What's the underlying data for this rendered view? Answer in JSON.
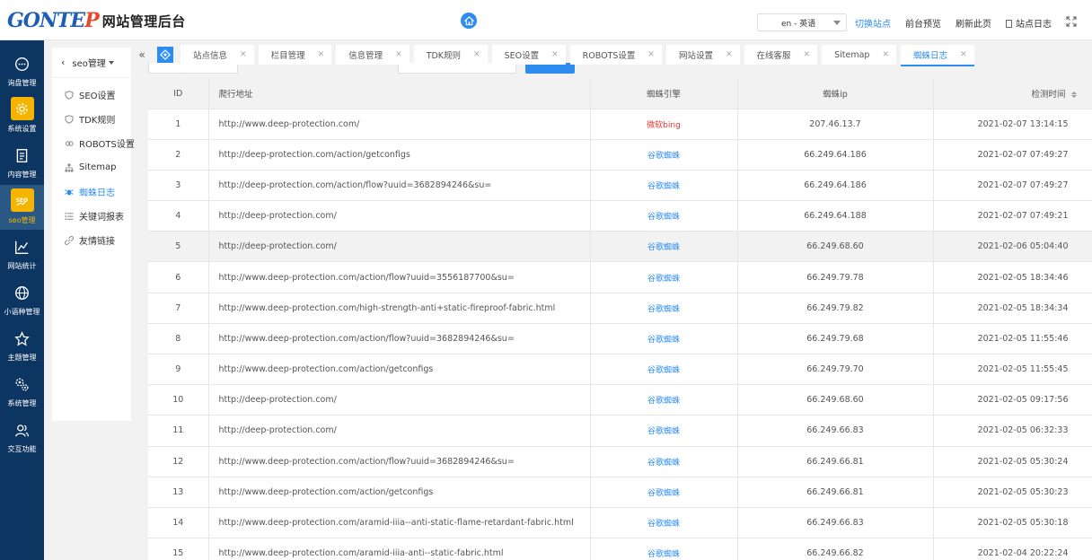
{
  "header": {
    "logo_text_main": "GONTE",
    "logo_text_p": "P",
    "title": "网站管理后台",
    "language": "en - 英语",
    "links": {
      "switch_site": "切换站点",
      "preview": "前台预览",
      "refresh": "刷新此页",
      "site_log": "站点日志"
    }
  },
  "sidebar": {
    "items": [
      {
        "label": "询盘管理",
        "icon": "chat-icon"
      },
      {
        "label": "系统设置",
        "icon": "gear-icon"
      },
      {
        "label": "内容管理",
        "icon": "document-icon"
      },
      {
        "label": "seo管理",
        "icon": "seo-icon"
      },
      {
        "label": "网站统计",
        "icon": "chart-icon"
      },
      {
        "label": "小语种管理",
        "icon": "globe-icon"
      },
      {
        "label": "主题管理",
        "icon": "theme-icon"
      },
      {
        "label": "系统管理",
        "icon": "cogs-icon"
      },
      {
        "label": "交互功能",
        "icon": "users-icon"
      }
    ]
  },
  "submenu": {
    "title": "seo管理",
    "items": [
      {
        "label": "SEO设置",
        "icon": "shield-icon"
      },
      {
        "label": "TDK规则",
        "icon": "shield-icon"
      },
      {
        "label": "ROBOTS设置",
        "icon": "robot-icon"
      },
      {
        "label": "Sitemap",
        "icon": "sitemap-icon"
      },
      {
        "label": "蜘蛛日志",
        "icon": "spider-icon"
      },
      {
        "label": "关键词报表",
        "icon": "list-icon"
      },
      {
        "label": "友情链接",
        "icon": "link-icon"
      }
    ]
  },
  "tabs": [
    {
      "label": "站点信息"
    },
    {
      "label": "栏目管理"
    },
    {
      "label": "信息管理"
    },
    {
      "label": "TDK规则"
    },
    {
      "label": "SEO设置"
    },
    {
      "label": "ROBOTS设置"
    },
    {
      "label": "网站设置"
    },
    {
      "label": "在线客服"
    },
    {
      "label": "Sitemap"
    },
    {
      "label": "蜘蛛日志"
    }
  ],
  "table": {
    "headers": {
      "id": "ID",
      "url": "爬行地址",
      "engine": "蜘蛛引擎",
      "ip": "蜘蛛ip",
      "time": "检测时间"
    },
    "colors": {
      "bing": "#e8382c",
      "google": "#2d8cf0"
    },
    "rows": [
      {
        "id": "1",
        "url": "http://www.deep-protection.com/",
        "engine": "微软bing",
        "engine_type": "bing",
        "ip": "207.46.13.7",
        "time": "2021-02-07 13:14:15"
      },
      {
        "id": "2",
        "url": "http://deep-protection.com/action/getconfigs",
        "engine": "谷歌蜘蛛",
        "engine_type": "google",
        "ip": "66.249.64.186",
        "time": "2021-02-07 07:49:27"
      },
      {
        "id": "3",
        "url": "http://deep-protection.com/action/flow?uuid=3682894246&su=",
        "engine": "谷歌蜘蛛",
        "engine_type": "google",
        "ip": "66.249.64.186",
        "time": "2021-02-07 07:49:27"
      },
      {
        "id": "4",
        "url": "http://deep-protection.com/",
        "engine": "谷歌蜘蛛",
        "engine_type": "google",
        "ip": "66.249.64.188",
        "time": "2021-02-07 07:49:21"
      },
      {
        "id": "5",
        "url": "http://deep-protection.com/",
        "engine": "谷歌蜘蛛",
        "engine_type": "google",
        "ip": "66.249.68.60",
        "time": "2021-02-06 05:04:40"
      },
      {
        "id": "6",
        "url": "http://www.deep-protection.com/action/flow?uuid=3556187700&su=",
        "engine": "谷歌蜘蛛",
        "engine_type": "google",
        "ip": "66.249.79.78",
        "time": "2021-02-05 18:34:46"
      },
      {
        "id": "7",
        "url": "http://www.deep-protection.com/high-strength-anti+static-fireproof-fabric.html",
        "engine": "谷歌蜘蛛",
        "engine_type": "google",
        "ip": "66.249.79.82",
        "time": "2021-02-05 18:34:34"
      },
      {
        "id": "8",
        "url": "http://www.deep-protection.com/action/flow?uuid=3682894246&su=",
        "engine": "谷歌蜘蛛",
        "engine_type": "google",
        "ip": "66.249.79.68",
        "time": "2021-02-05 11:55:46"
      },
      {
        "id": "9",
        "url": "http://www.deep-protection.com/action/getconfigs",
        "engine": "谷歌蜘蛛",
        "engine_type": "google",
        "ip": "66.249.79.70",
        "time": "2021-02-05 11:55:45"
      },
      {
        "id": "10",
        "url": "http://deep-protection.com/",
        "engine": "谷歌蜘蛛",
        "engine_type": "google",
        "ip": "66.249.68.60",
        "time": "2021-02-05 09:17:56"
      },
      {
        "id": "11",
        "url": "http://deep-protection.com/",
        "engine": "谷歌蜘蛛",
        "engine_type": "google",
        "ip": "66.249.66.83",
        "time": "2021-02-05 06:32:33"
      },
      {
        "id": "12",
        "url": "http://www.deep-protection.com/action/flow?uuid=3682894246&su=",
        "engine": "谷歌蜘蛛",
        "engine_type": "google",
        "ip": "66.249.66.81",
        "time": "2021-02-05 05:30:24"
      },
      {
        "id": "13",
        "url": "http://www.deep-protection.com/action/getconfigs",
        "engine": "谷歌蜘蛛",
        "engine_type": "google",
        "ip": "66.249.66.81",
        "time": "2021-02-05 05:30:23"
      },
      {
        "id": "14",
        "url": "http://www.deep-protection.com/aramid-iiia--anti-static-flame-retardant-fabric.html",
        "engine": "谷歌蜘蛛",
        "engine_type": "google",
        "ip": "66.249.66.83",
        "time": "2021-02-05 05:30:18"
      },
      {
        "id": "15",
        "url": "http://www.deep-protection.com/aramid-iiia-anti--static-fabric.html",
        "engine": "谷歌蜘蛛",
        "engine_type": "google",
        "ip": "66.249.66.82",
        "time": "2021-02-04 20:22:24"
      }
    ]
  }
}
